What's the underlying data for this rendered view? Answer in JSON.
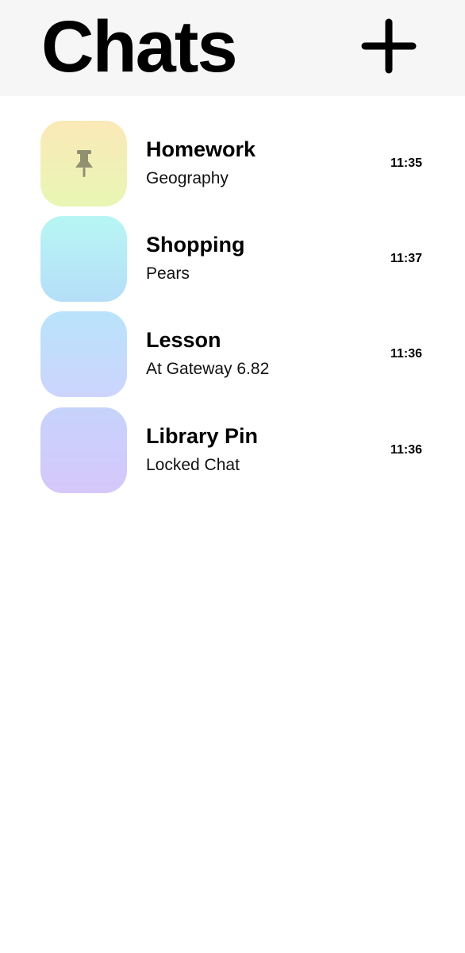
{
  "header": {
    "title": "Chats",
    "add_icon": "plus-icon"
  },
  "chats": [
    {
      "name": "Homework",
      "preview": "Geography",
      "time": "11:35",
      "pinned": true,
      "icon": "pin-icon",
      "colors": [
        "#fbe9b8",
        "#e8f6b4"
      ]
    },
    {
      "name": "Shopping",
      "preview": "Pears",
      "time": "11:37",
      "pinned": false,
      "colors": [
        "#b7f6f4",
        "#b6def8"
      ]
    },
    {
      "name": "Lesson",
      "preview": "At Gateway 6.82",
      "time": "11:36",
      "pinned": false,
      "colors": [
        "#b9e4fb",
        "#ccd4fd"
      ]
    },
    {
      "name": "Library Pin",
      "preview": "Locked Chat",
      "time": "11:36",
      "pinned": false,
      "colors": [
        "#c6d3fb",
        "#d6c7fb"
      ]
    }
  ]
}
